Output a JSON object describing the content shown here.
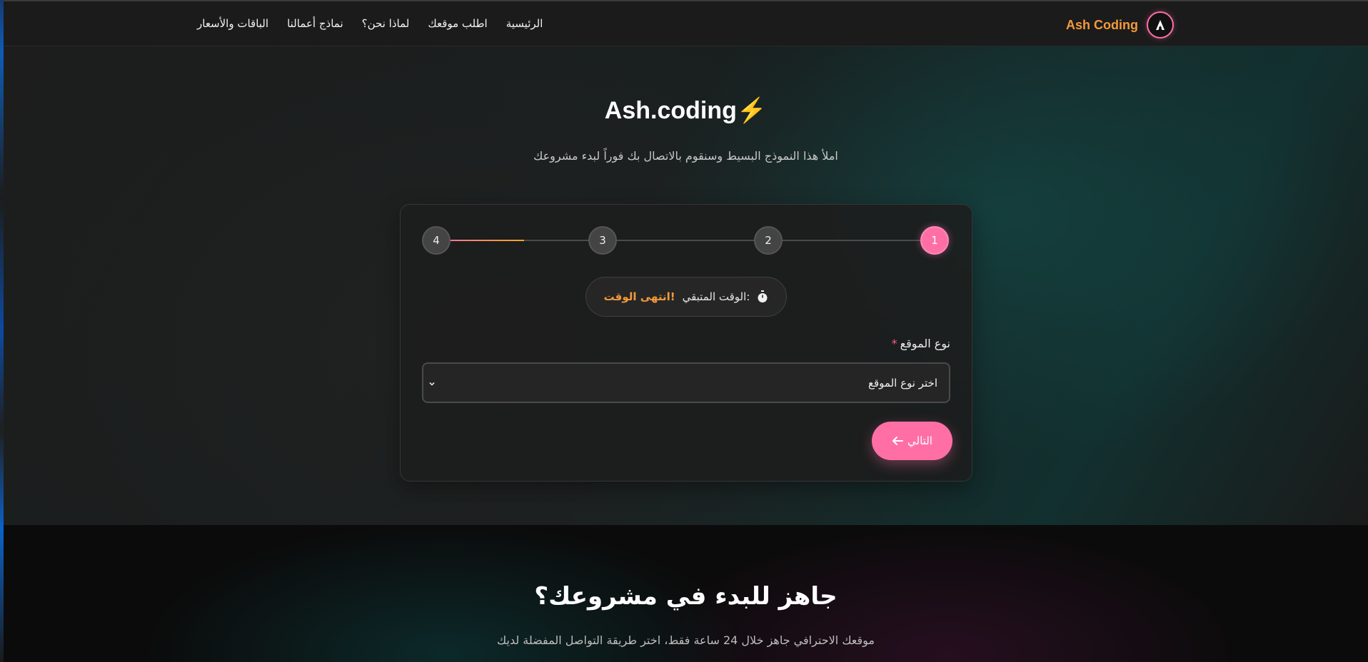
{
  "navbar": {
    "brand_name": "Ash Coding",
    "logo_icon": "a-logo-icon",
    "links": [
      {
        "label": "الرئيسية"
      },
      {
        "label": "اطلب موقعك"
      },
      {
        "label": "لماذا نحن؟"
      },
      {
        "label": "نماذج أعمالنا"
      },
      {
        "label": "الباقات والأسعار"
      }
    ]
  },
  "hero": {
    "title": "Ash.coding",
    "title_emoji": "⚡",
    "subtitle": "املأ هذا النموذج البسيط وسنقوم بالاتصال بك فوراً لبدء مشروعك"
  },
  "form": {
    "steps": [
      {
        "number": "1",
        "active": true
      },
      {
        "number": "2",
        "active": false
      },
      {
        "number": "3",
        "active": false
      },
      {
        "number": "4",
        "active": false
      }
    ],
    "timer": {
      "icon": "stopwatch-icon",
      "label": "الوقت المتبقي:",
      "value": "انتهى الوقت!"
    },
    "site_type": {
      "label": "نوع الموقع",
      "required_mark": "*",
      "selected": "اختر نوع الموقع"
    },
    "next_button": {
      "label": "التالي",
      "icon": "arrow-left-icon"
    }
  },
  "cta": {
    "title": "جاهز للبدء في مشروعك؟",
    "subtitle": "موقعك الاحترافي جاهز خلال 24 ساعة فقط، اختر طريقة التواصل المفضلة لديك"
  },
  "colors": {
    "accent_pink": "#ff6fa6",
    "accent_orange": "#f39a3b",
    "background": "#141414"
  }
}
